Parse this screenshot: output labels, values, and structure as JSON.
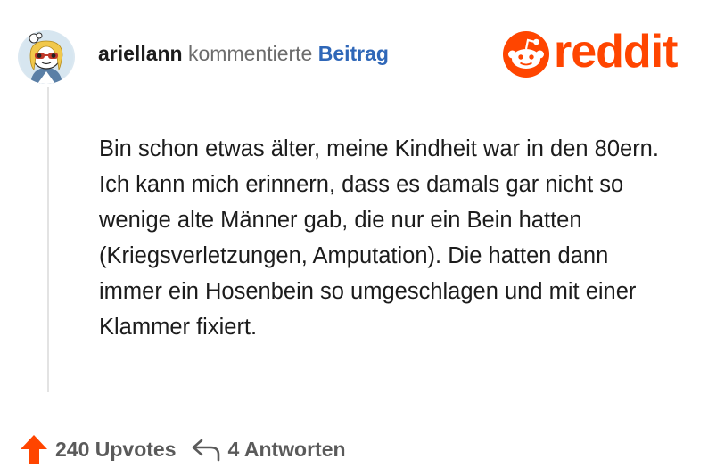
{
  "comment": {
    "username": "ariellann",
    "action_text": "kommentierte",
    "post_link_label": "Beitrag",
    "avatar_icon": "snoo-sunglasses-avatar-icon",
    "body": "Bin schon etwas älter, meine Kindheit war in den 80ern. Ich kann mich erinnern, dass es damals gar nicht so wenige alte Männer gab, die nur ein Bein hatten (Kriegsverletzungen, Amputation). Die hatten dann immer ein Hosenbein so umgeschlagen und mit einer Klammer fixiert."
  },
  "brand": {
    "name": "reddit",
    "icon": "reddit-snoo-icon",
    "color": "#ff4500"
  },
  "footer": {
    "upvote_icon": "upvote-arrow-icon",
    "upvotes_label": "240 Upvotes",
    "reply_icon": "reply-arrow-icon",
    "replies_label": "4 Antworten"
  },
  "colors": {
    "accent": "#ff4500",
    "link": "#2f67b8",
    "text": "#1c1c1c",
    "muted": "#6c6c6c"
  }
}
